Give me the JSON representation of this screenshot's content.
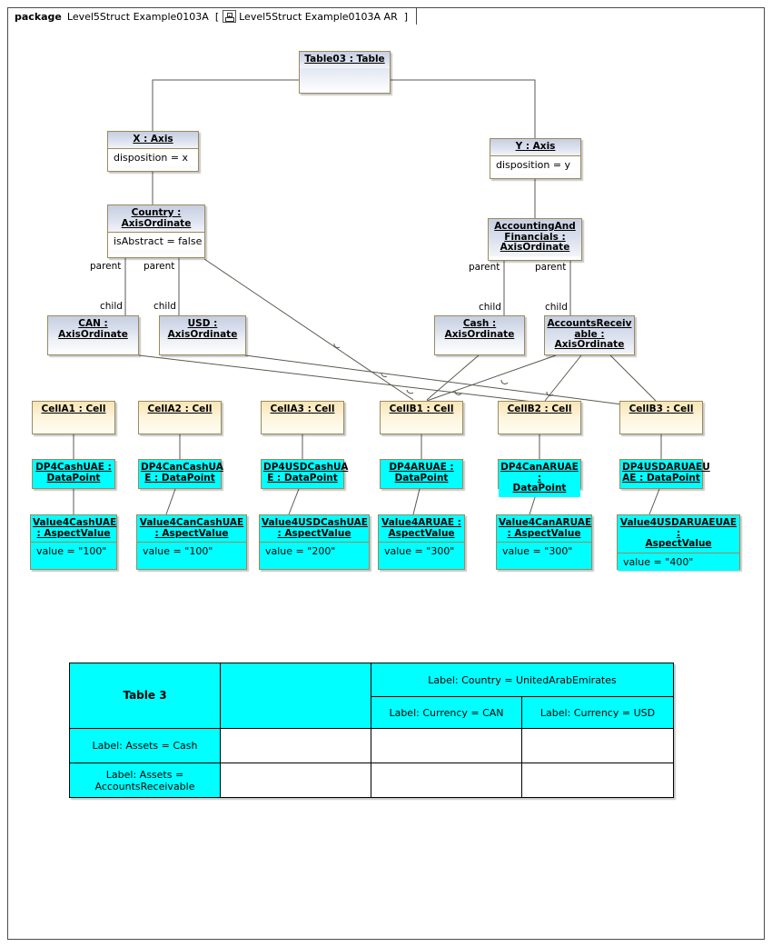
{
  "package": {
    "keyword": "package",
    "name": "Level5Struct Example0103A",
    "bracket_open": "[",
    "frame_icon": "diagram-frame-icon",
    "diagram_name": "Level5Struct Example0103A AR",
    "bracket_close": "]"
  },
  "nodes": {
    "table03": {
      "title": "Table03 : Table"
    },
    "x_axis": {
      "title": "X : Axis",
      "attr": "disposition = x"
    },
    "y_axis": {
      "title": "Y : Axis",
      "attr": "disposition = y"
    },
    "country": {
      "title_line1": "Country :",
      "title_line2": "AxisOrdinate",
      "attr": "isAbstract = false"
    },
    "accfin": {
      "title_line1": "AccountingAnd",
      "title_line2": "Financials :",
      "title_line3": "AxisOrdinate"
    },
    "can": {
      "title_line1": "CAN :",
      "title_line2": "AxisOrdinate"
    },
    "usd": {
      "title_line1": "USD :",
      "title_line2": "AxisOrdinate"
    },
    "cash": {
      "title_line1": "Cash :",
      "title_line2": "AxisOrdinate"
    },
    "ar": {
      "title_line1": "AccountsReceiv",
      "title_line2": "able :",
      "title_line3": "AxisOrdinate"
    },
    "cellA1": {
      "title": "CellA1 : Cell"
    },
    "cellA2": {
      "title": "CellA2 : Cell"
    },
    "cellA3": {
      "title": "CellA3 : Cell"
    },
    "cellB1": {
      "title": "CellB1 : Cell"
    },
    "cellB2": {
      "title": "CellB2 : Cell"
    },
    "cellB3": {
      "title": "CellB3 : Cell"
    },
    "dp1": {
      "title_line1": "DP4CashUAE :",
      "title_line2": "DataPoint"
    },
    "dp2": {
      "title_line1": "DP4CanCashUA",
      "title_line2": "E : DataPoint"
    },
    "dp3": {
      "title_line1": "DP4USDCashUA",
      "title_line2": "E : DataPoint"
    },
    "dp4": {
      "title_line1": "DP4ARUAE :",
      "title_line2": "DataPoint"
    },
    "dp5": {
      "title_line1": "DP4CanARUAE :",
      "title_line2": "DataPoint"
    },
    "dp6": {
      "title_line1": "DP4USDARUAEU",
      "title_line2": "AE : DataPoint"
    },
    "av1": {
      "title_line1": "Value4CashUAE",
      "title_line2": ": AspectValue",
      "attr": "value = \"100\""
    },
    "av2": {
      "title_line1": "Value4CanCashUAE",
      "title_line2": ": AspectValue",
      "attr": "value = \"100\""
    },
    "av3": {
      "title_line1": "Value4USDCashUAE",
      "title_line2": ": AspectValue",
      "attr": "value = \"200\""
    },
    "av4": {
      "title_line1": "Value4ARUAE :",
      "title_line2": "AspectValue",
      "attr": "value = \"300\""
    },
    "av5": {
      "title_line1": "Value4CanARUAE",
      "title_line2": ": AspectValue",
      "attr": "value = \"300\""
    },
    "av6": {
      "title_line1": "Value4USDARUAEUAE :",
      "title_line2": "AspectValue",
      "attr": "value = \"400\""
    }
  },
  "edge_labels": {
    "parent": "parent",
    "child": "child"
  },
  "render_table": {
    "title": "Table 3",
    "country_header": "Label: Country = UnitedArabEmirates",
    "currency_can": "Label: Currency = CAN",
    "currency_usd": "Label: Currency = USD",
    "row_cash": "Label: Assets = Cash",
    "row_ar_line1": "Label: Assets =",
    "row_ar_line2": "AccountsReceivable"
  },
  "colors": {
    "cyan": "#00ffff",
    "cream": "#fdf0cd",
    "blue_gray": "#d6dcea",
    "border": "#9a8b5e",
    "line": "#5a5a50"
  }
}
